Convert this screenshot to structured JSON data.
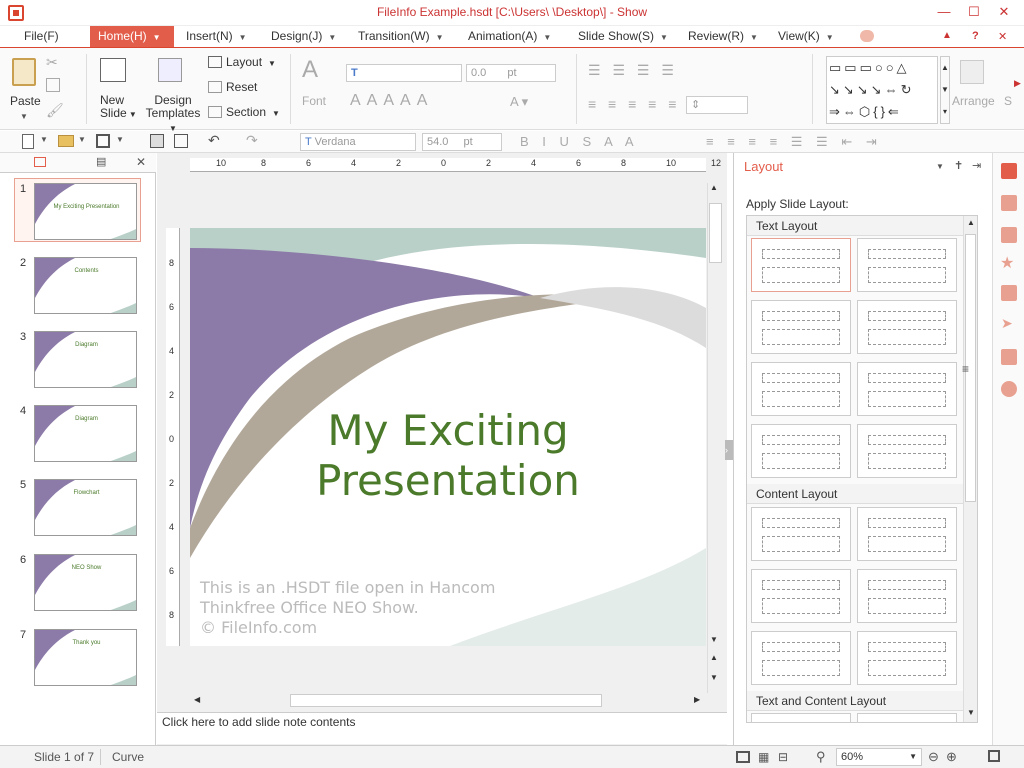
{
  "window": {
    "title": "FileInfo Example.hsdt [C:\\Users\\                    \\Desktop\\] - Show",
    "controls": [
      "—",
      "☐",
      "✕"
    ],
    "menubar_right": [
      "▲",
      "?",
      "✕"
    ]
  },
  "menu": {
    "tabs": [
      {
        "label": "File(F)",
        "has_arrow": false,
        "active": false
      },
      {
        "label": "Home(H)",
        "has_arrow": true,
        "active": true
      },
      {
        "label": "Insert(N)",
        "has_arrow": true,
        "active": false
      },
      {
        "label": "Design(J)",
        "has_arrow": true,
        "active": false
      },
      {
        "label": "Transition(W)",
        "has_arrow": true,
        "active": false
      },
      {
        "label": "Animation(A)",
        "has_arrow": true,
        "active": false
      },
      {
        "label": "Slide Show(S)",
        "has_arrow": true,
        "active": false
      },
      {
        "label": "Review(R)",
        "has_arrow": true,
        "active": false
      },
      {
        "label": "View(K)",
        "has_arrow": true,
        "active": false
      }
    ]
  },
  "ribbon": {
    "paste": "Paste",
    "new_slide": "New Slide",
    "design_templates": "Design Templates",
    "layout": "Layout",
    "reset": "Reset",
    "section": "Section",
    "font": "Font",
    "font_size_value": "0.0",
    "font_size_unit": "pt",
    "arrange": "Arrange",
    "style": "S"
  },
  "toolbar2": {
    "font_name": "Verdana",
    "font_size": "54.0",
    "font_unit": "pt"
  },
  "thumbnails": [
    {
      "num": "1",
      "label": "My Exciting Presentation",
      "selected": true
    },
    {
      "num": "2",
      "label": "Contents",
      "selected": false
    },
    {
      "num": "3",
      "label": "Diagram",
      "selected": false
    },
    {
      "num": "4",
      "label": "Diagram",
      "selected": false
    },
    {
      "num": "5",
      "label": "Flowchart",
      "selected": false
    },
    {
      "num": "6",
      "label": "NEO Show",
      "selected": false
    },
    {
      "num": "7",
      "label": "Thank you",
      "selected": false
    }
  ],
  "ruler": {
    "h_ticks": [
      "10",
      "8",
      "6",
      "4",
      "2",
      "0",
      "2",
      "4",
      "6",
      "8",
      "10",
      "12"
    ],
    "v_ticks": [
      "8",
      "6",
      "4",
      "2",
      "0",
      "2",
      "4",
      "6",
      "8"
    ]
  },
  "slide": {
    "title_line1": "My Exciting",
    "title_line2": "Presentation",
    "credit_line1": "This is an .HSDT file open in Hancom",
    "credit_line2": "Thinkfree Office NEO Show.",
    "credit_line3": "© FileInfo.com",
    "colors": {
      "purple": "#8c7aa8",
      "taupe": "#b2a89a",
      "teal": "#b9d0c8",
      "title": "#4a7a2a"
    }
  },
  "notes": {
    "placeholder": "Click here to add slide note contents"
  },
  "layout_pane": {
    "title": "Layout",
    "apply_label": "Apply Slide Layout:",
    "groups": [
      "Text Layout",
      "Content Layout",
      "Text and Content Layout"
    ]
  },
  "status": {
    "slide": "Slide 1 of 7",
    "theme": "Curve",
    "zoom": "60%"
  }
}
